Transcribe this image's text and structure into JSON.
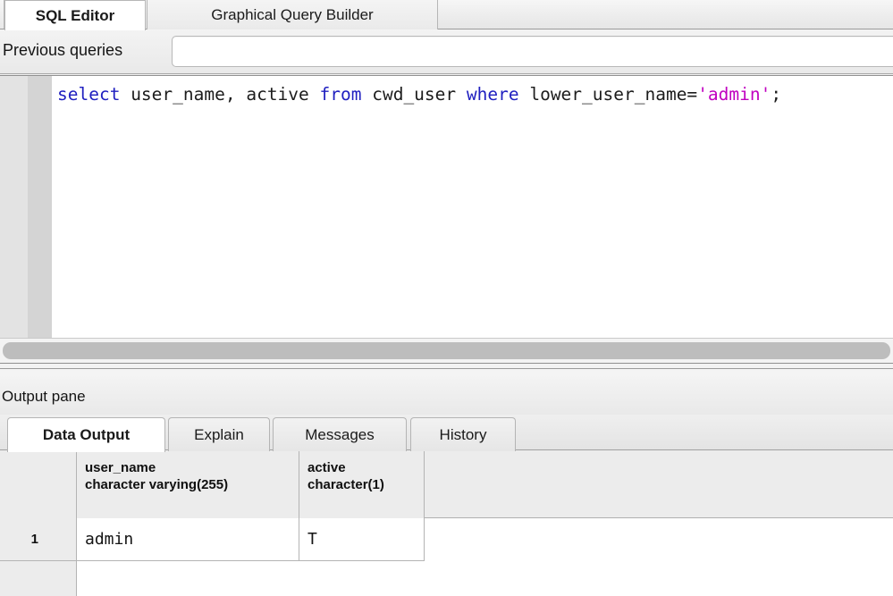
{
  "top_tabs": [
    {
      "id": "sql",
      "label": "SQL Editor",
      "active": true
    },
    {
      "id": "gqb",
      "label": "Graphical Query Builder",
      "active": false
    }
  ],
  "previous_queries": {
    "label": "Previous queries",
    "value": "",
    "placeholder": ""
  },
  "sql_editor": {
    "tokens": [
      {
        "text": "select",
        "type": "keyword"
      },
      {
        "text": " user_name, active ",
        "type": "plain"
      },
      {
        "text": "from",
        "type": "keyword"
      },
      {
        "text": " cwd_user ",
        "type": "plain"
      },
      {
        "text": "where",
        "type": "keyword"
      },
      {
        "text": " lower_user_name=",
        "type": "plain"
      },
      {
        "text": "'admin'",
        "type": "string"
      },
      {
        "text": ";",
        "type": "plain"
      }
    ],
    "full_text": "select user_name, active from cwd_user where lower_user_name='admin';",
    "keyword_color": "#2020c0",
    "string_color": "#c000c0",
    "text_color": "#1c1c1c"
  },
  "output_pane": {
    "label": "Output pane",
    "tabs": [
      {
        "id": "data",
        "label": "Data Output",
        "active": true
      },
      {
        "id": "expl",
        "label": "Explain",
        "active": false
      },
      {
        "id": "msgs",
        "label": "Messages",
        "active": false
      },
      {
        "id": "hist",
        "label": "History",
        "active": false
      }
    ],
    "grid": {
      "columns": [
        {
          "name": "user_name",
          "type": "character varying(255)"
        },
        {
          "name": "active",
          "type": "character(1)"
        }
      ],
      "rows": [
        {
          "num": "1",
          "user_name": "admin",
          "active": "T"
        }
      ]
    }
  }
}
